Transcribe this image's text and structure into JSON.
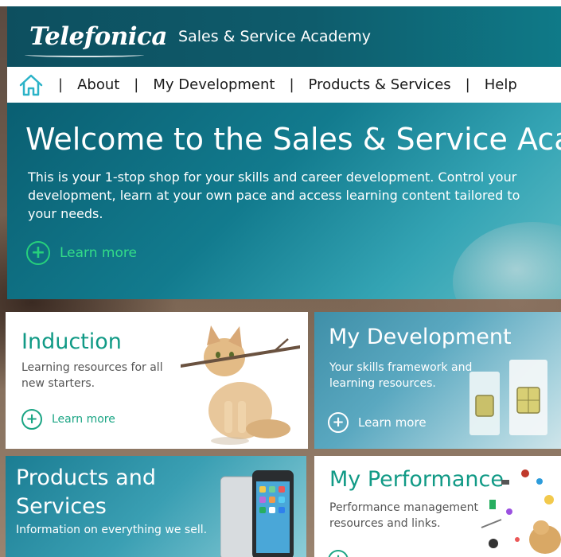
{
  "header": {
    "logo_text": "Telefonica",
    "app_title": "Sales & Service Academy"
  },
  "nav": {
    "home_icon": "home-icon",
    "separator": "|",
    "items": [
      {
        "label": "About"
      },
      {
        "label": "My Development"
      },
      {
        "label": "Products & Services"
      },
      {
        "label": "Help"
      }
    ]
  },
  "hero": {
    "title": "Welcome to the Sales & Service Academy",
    "text": "This is your 1-stop shop for your skills and career development. Control your development, learn at your own pace and access learning content tailored to your needs.",
    "learn_more": "Learn more"
  },
  "tiles": {
    "induction": {
      "title": "Induction",
      "desc": "Learning resources for all new starters.",
      "learn_more": "Learn more",
      "image_icon": "cat-with-stick-image"
    },
    "my_development": {
      "title": "My Development",
      "desc": "Your skills framework and learning resources.",
      "learn_more": "Learn more",
      "image_icon": "sim-cards-image"
    },
    "products": {
      "title": "Products and Services",
      "desc": "Information on everything we sell.",
      "image_icon": "smartphone-image"
    },
    "performance": {
      "title": "My Performance",
      "desc": "Performance management resources and links.",
      "image_icon": "objects-collage-image"
    }
  },
  "colors": {
    "brand_dark_teal": "#0d4f5f",
    "accent_green": "#1aa584",
    "hero_learn_green": "#33dc88"
  }
}
